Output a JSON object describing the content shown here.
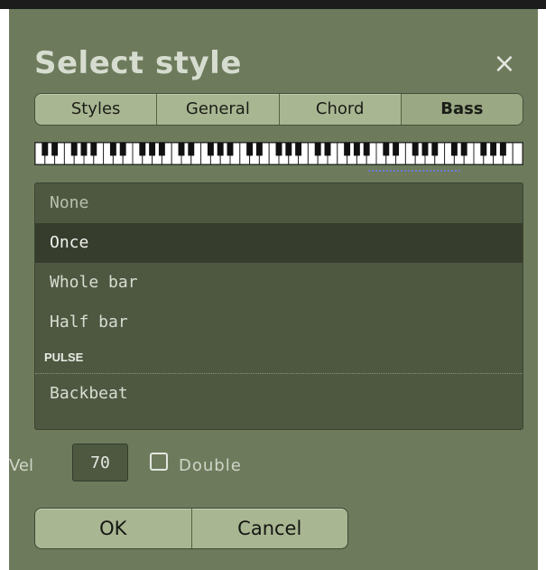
{
  "dialog": {
    "title": "Select style",
    "close_glyph": "×"
  },
  "tabs": [
    {
      "label": "Styles",
      "active": false
    },
    {
      "label": "General",
      "active": false
    },
    {
      "label": "Chord",
      "active": false
    },
    {
      "label": "Bass",
      "active": true
    }
  ],
  "keyboard": {
    "octaves": 7
  },
  "list": {
    "items": [
      "None",
      "Once",
      "Whole bar",
      "Half bar"
    ],
    "selected": "Once",
    "section": "PULSE",
    "section_items": [
      "Backbeat"
    ]
  },
  "velocity": {
    "label": "Vel",
    "value": "70"
  },
  "double": {
    "label": "Double",
    "checked": false
  },
  "buttons": {
    "ok": "OK",
    "cancel": "Cancel"
  },
  "colors": {
    "dialog_bg": "#6d7b5c",
    "list_bg": "#4e5841",
    "selected_row": "#363d2d",
    "tab_bg": "#a9b692",
    "keyboard_marker": "#6f7bd6"
  }
}
